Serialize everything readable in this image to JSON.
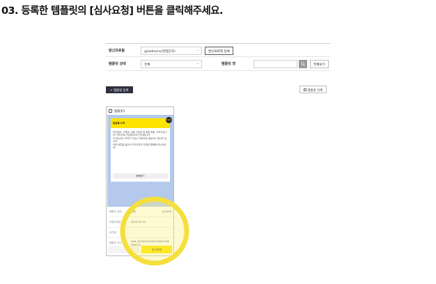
{
  "step": {
    "title": "03. 등록한 템플릿의 [심사요청] 버튼을 클릭해주세요."
  },
  "filter": {
    "sender_label": "발신프로필",
    "sender_value": "@hathsms(현업문자)",
    "sender_register_button": "발신프로필 등록",
    "status_label": "템플릿 상태",
    "status_value": "전체",
    "name_label": "템플릿 명",
    "name_value": "",
    "view_all_button": "전체보기"
  },
  "actions": {
    "add_button": "+ 템플릿 등록",
    "delete_button": "템플릿 삭제"
  },
  "card": {
    "name": "템플릿1",
    "preview": {
      "header": "알림톡 도착",
      "icon_text": "kakao",
      "body": "반가워요, 고객님! 다음 가입한 첫 회원 명령, 카카오입니다! 카카오에 가입해주셔서 감사합니다.\n이 메시지는 카카오 가입시 자동으로 발송되는 메시지 입니다.\n아래 버튼을 눌러서 카카오만의 다양한 혜택을 만나보세요!",
      "button": "혜택받기"
    },
    "info": {
      "status_label": "템플릿 상태",
      "status_value": "등록",
      "detail_link": "검사상세",
      "date_label": "최종요청일",
      "date_value": "2023-02-14",
      "approve_label": "승인일",
      "approve_value": "-",
      "code_label": "템플릿 코드",
      "code_value": "hatt_20230214161015524196\n996115"
    },
    "review_button": "심사요청"
  },
  "colors": {
    "highlight": "#f5df3c",
    "accent_yellow": "#fee500",
    "dark_button": "#2e3140",
    "preview_bg": "#b4c9eb"
  }
}
